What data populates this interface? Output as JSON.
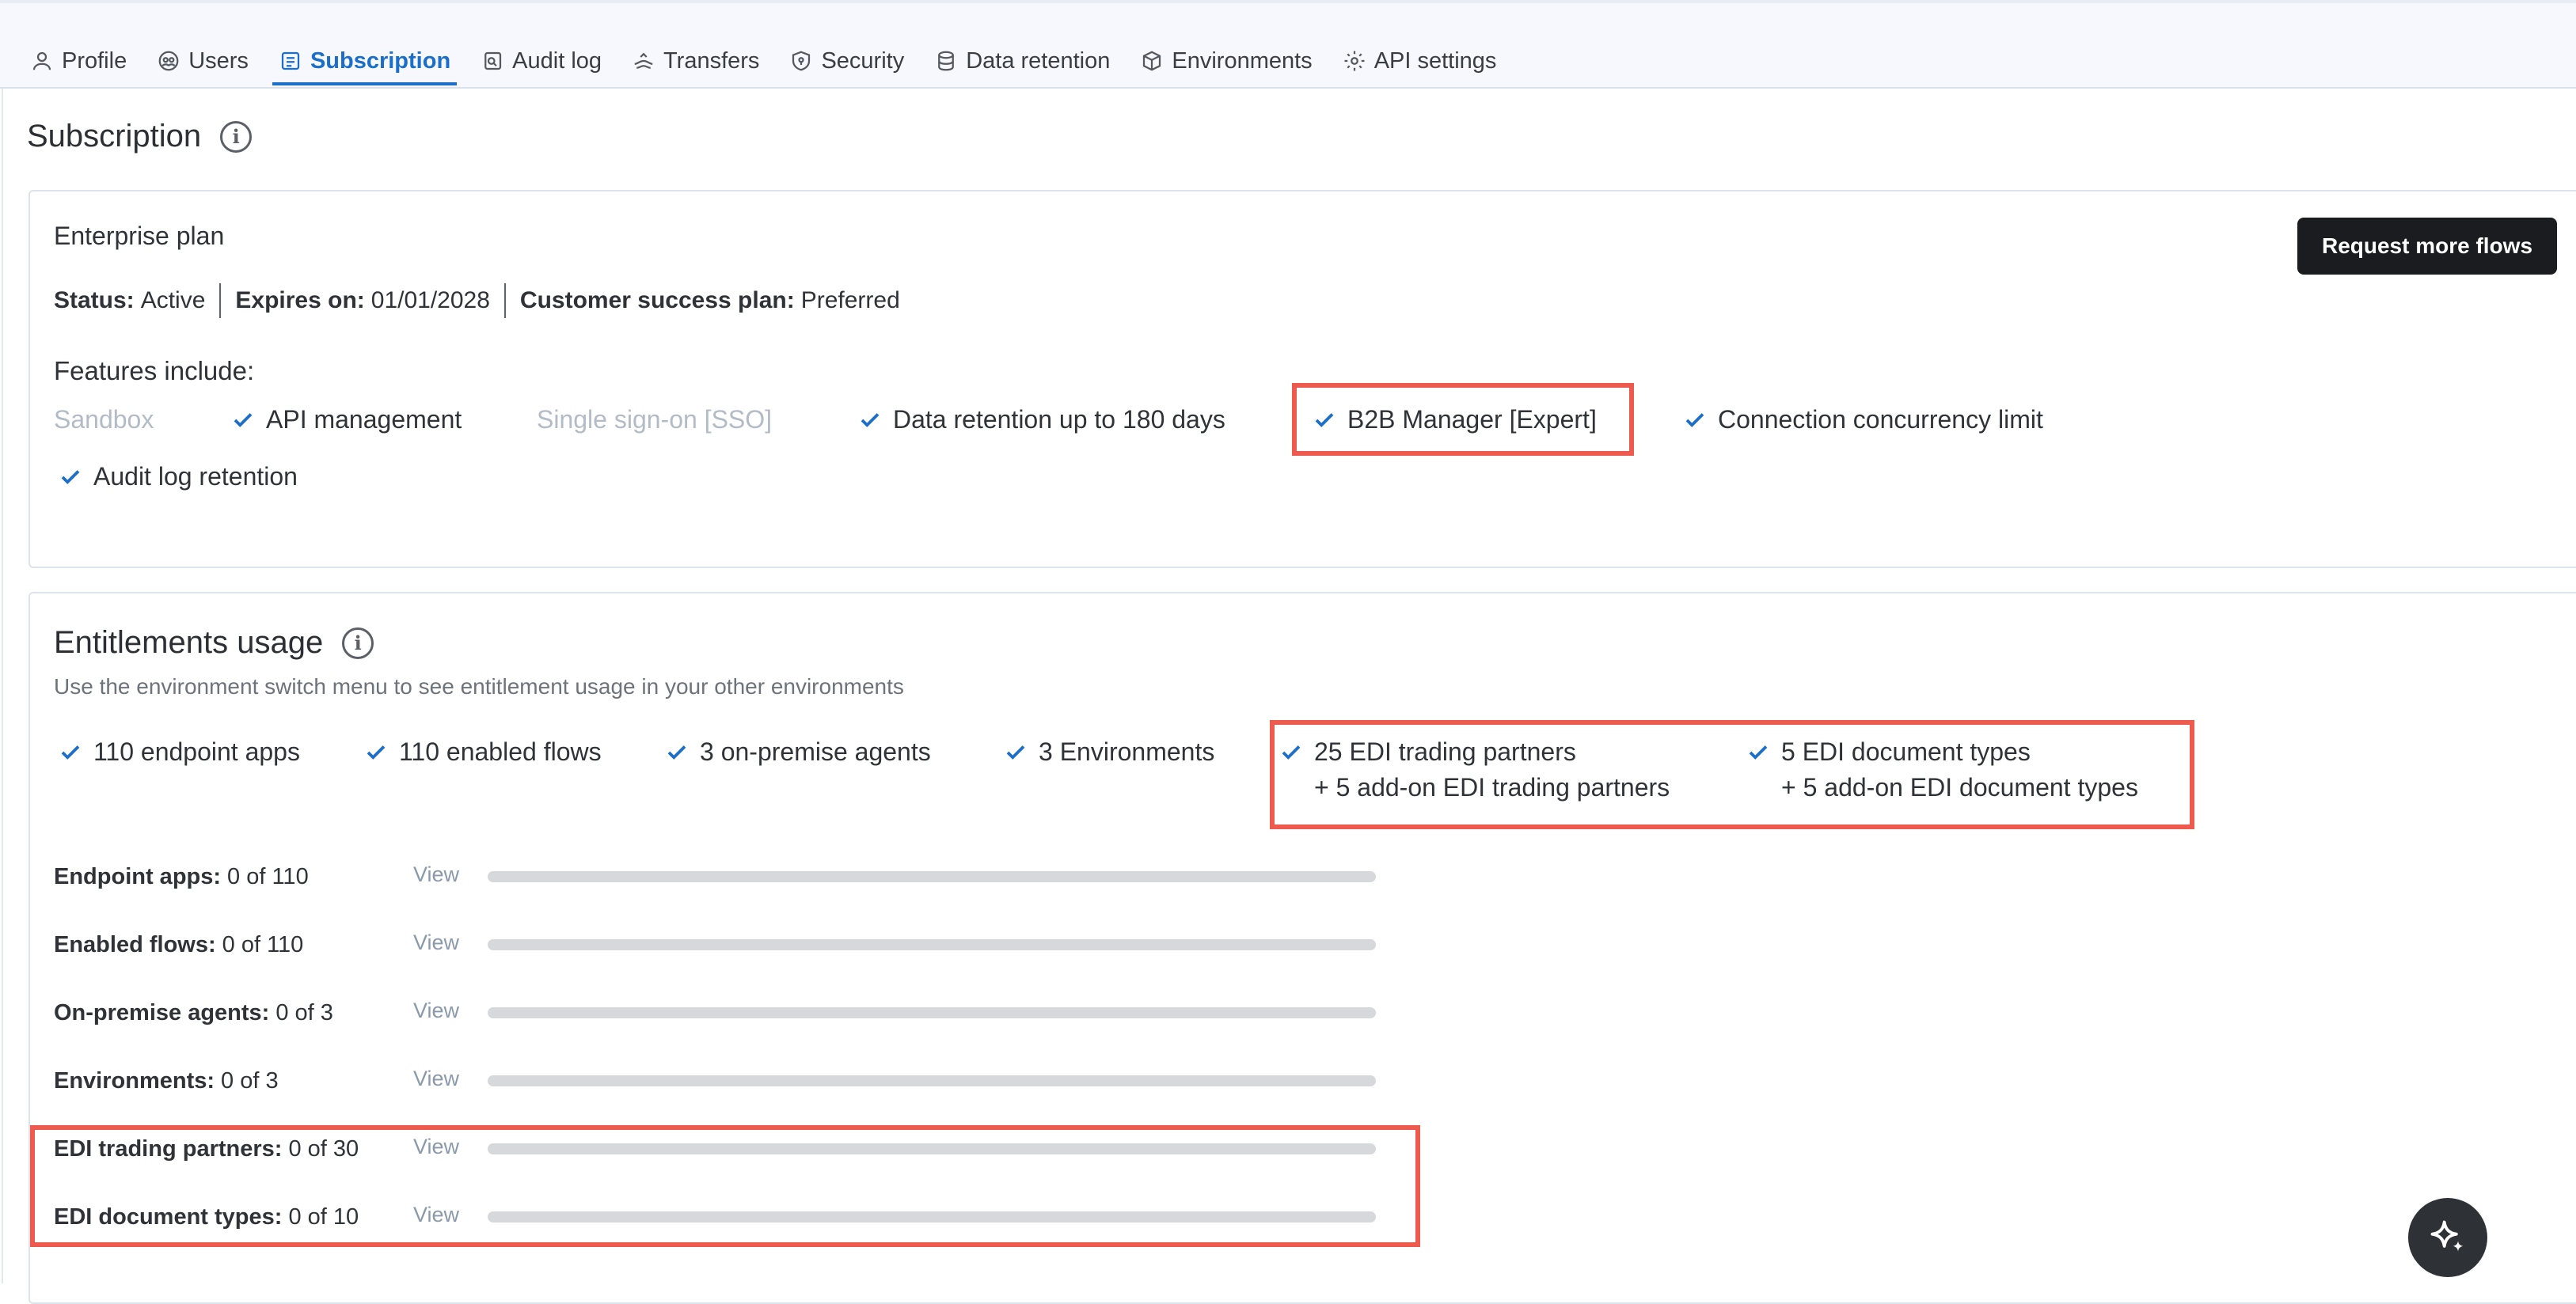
{
  "tabs": [
    {
      "label": "Profile",
      "icon": "person-icon",
      "active": false
    },
    {
      "label": "Users",
      "icon": "users-icon",
      "active": false
    },
    {
      "label": "Subscription",
      "icon": "subscription-icon",
      "active": true
    },
    {
      "label": "Audit log",
      "icon": "audit-log-icon",
      "active": false
    },
    {
      "label": "Transfers",
      "icon": "transfers-icon",
      "active": false
    },
    {
      "label": "Security",
      "icon": "shield-icon",
      "active": false
    },
    {
      "label": "Data retention",
      "icon": "database-icon",
      "active": false
    },
    {
      "label": "Environments",
      "icon": "cube-icon",
      "active": false
    },
    {
      "label": "API settings",
      "icon": "gear-icon",
      "active": false
    }
  ],
  "page": {
    "title": "Subscription"
  },
  "plan": {
    "name": "Enterprise plan",
    "status_label": "Status:",
    "status_value": "Active",
    "expires_label": "Expires on:",
    "expires_value": "01/01/2028",
    "csp_label": "Customer success plan:",
    "csp_value": "Preferred",
    "request_button": "Request more flows",
    "features_label": "Features include:",
    "features": [
      {
        "label": "Sandbox",
        "enabled": false
      },
      {
        "label": "API management",
        "enabled": true
      },
      {
        "label": "Single sign-on [SSO]",
        "enabled": false
      },
      {
        "label": "Data retention up to 180 days",
        "enabled": true
      },
      {
        "label": "B2B Manager [Expert]",
        "enabled": true,
        "highlighted": true
      },
      {
        "label": "Connection concurrency limit",
        "enabled": true
      },
      {
        "label": "Audit log retention",
        "enabled": true
      }
    ]
  },
  "entitlements": {
    "title": "Entitlements usage",
    "subtitle": "Use the environment switch menu to see entitlement usage in your other environments",
    "items": [
      {
        "label": "110 endpoint apps"
      },
      {
        "label": "110 enabled flows"
      },
      {
        "label": "3 on-premise agents"
      },
      {
        "label": "3 Environments"
      },
      {
        "label": "25 EDI trading partners",
        "addon": "+ 5 add-on EDI trading partners"
      },
      {
        "label": "5 EDI document types",
        "addon": "+ 5 add-on EDI document types"
      }
    ],
    "view_label": "View",
    "usage": [
      {
        "label": "Endpoint apps:",
        "value": "0 of 110",
        "fraction": 0
      },
      {
        "label": "Enabled flows:",
        "value": "0 of 110",
        "fraction": 0
      },
      {
        "label": "On-premise agents:",
        "value": "0 of 3",
        "fraction": 0
      },
      {
        "label": "Environments:",
        "value": "0 of 3",
        "fraction": 0
      },
      {
        "label": "EDI trading partners:",
        "value": "0 of 30",
        "fraction": 0
      },
      {
        "label": "EDI document types:",
        "value": "0 of 10",
        "fraction": 0
      }
    ]
  },
  "colors": {
    "accent": "#1b6ec9",
    "highlight": "#ef5a4e",
    "disabled_text": "#b3bcc6",
    "button_bg": "#1a1c1f"
  },
  "fab": {
    "icon": "sparkle-icon"
  }
}
